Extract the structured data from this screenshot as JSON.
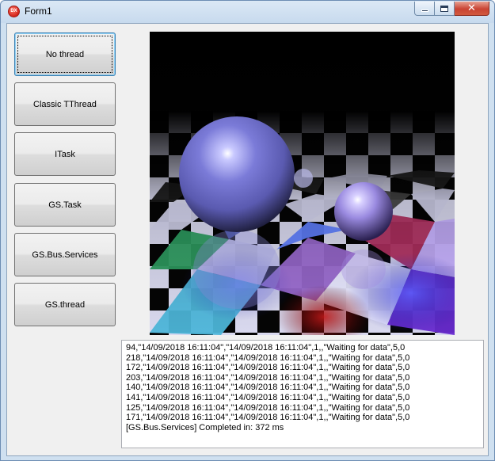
{
  "window": {
    "title": "Form1",
    "icon": "delphi-app-icon",
    "icon_text": "DX"
  },
  "buttons": [
    {
      "label": "No thread"
    },
    {
      "label": "Classic TThread"
    },
    {
      "label": "ITask"
    },
    {
      "label": "GS.Task"
    },
    {
      "label": "GS.Bus.Services"
    },
    {
      "label": "GS.thread"
    }
  ],
  "render_image": {
    "description_icon": "raytraced-spheres-image"
  },
  "log": {
    "lines": [
      "94,\"14/09/2018 16:11:04\",\"14/09/2018 16:11:04\",1,,\"Waiting for data\",5,0",
      "218,\"14/09/2018 16:11:04\",\"14/09/2018 16:11:04\",1,,\"Waiting for data\",5,0",
      "172,\"14/09/2018 16:11:04\",\"14/09/2018 16:11:04\",1,,\"Waiting for data\",5,0",
      "203,\"14/09/2018 16:11:04\",\"14/09/2018 16:11:04\",1,,\"Waiting for data\",5,0",
      "140,\"14/09/2018 16:11:04\",\"14/09/2018 16:11:04\",1,,\"Waiting for data\",5,0",
      "141,\"14/09/2018 16:11:04\",\"14/09/2018 16:11:04\",1,,\"Waiting for data\",5,0",
      "125,\"14/09/2018 16:11:04\",\"14/09/2018 16:11:04\",1,,\"Waiting for data\",5,0",
      "171,\"14/09/2018 16:11:04\",\"14/09/2018 16:11:04\",1,,\"Waiting for data\",5,0",
      "[GS.Bus.Services] Completed in: 372 ms"
    ]
  },
  "colors": {
    "title_bar": "#c7daee",
    "client_bg": "#f0f0f0",
    "close_button": "#c94433",
    "focus_border": "#3c7fb1"
  }
}
